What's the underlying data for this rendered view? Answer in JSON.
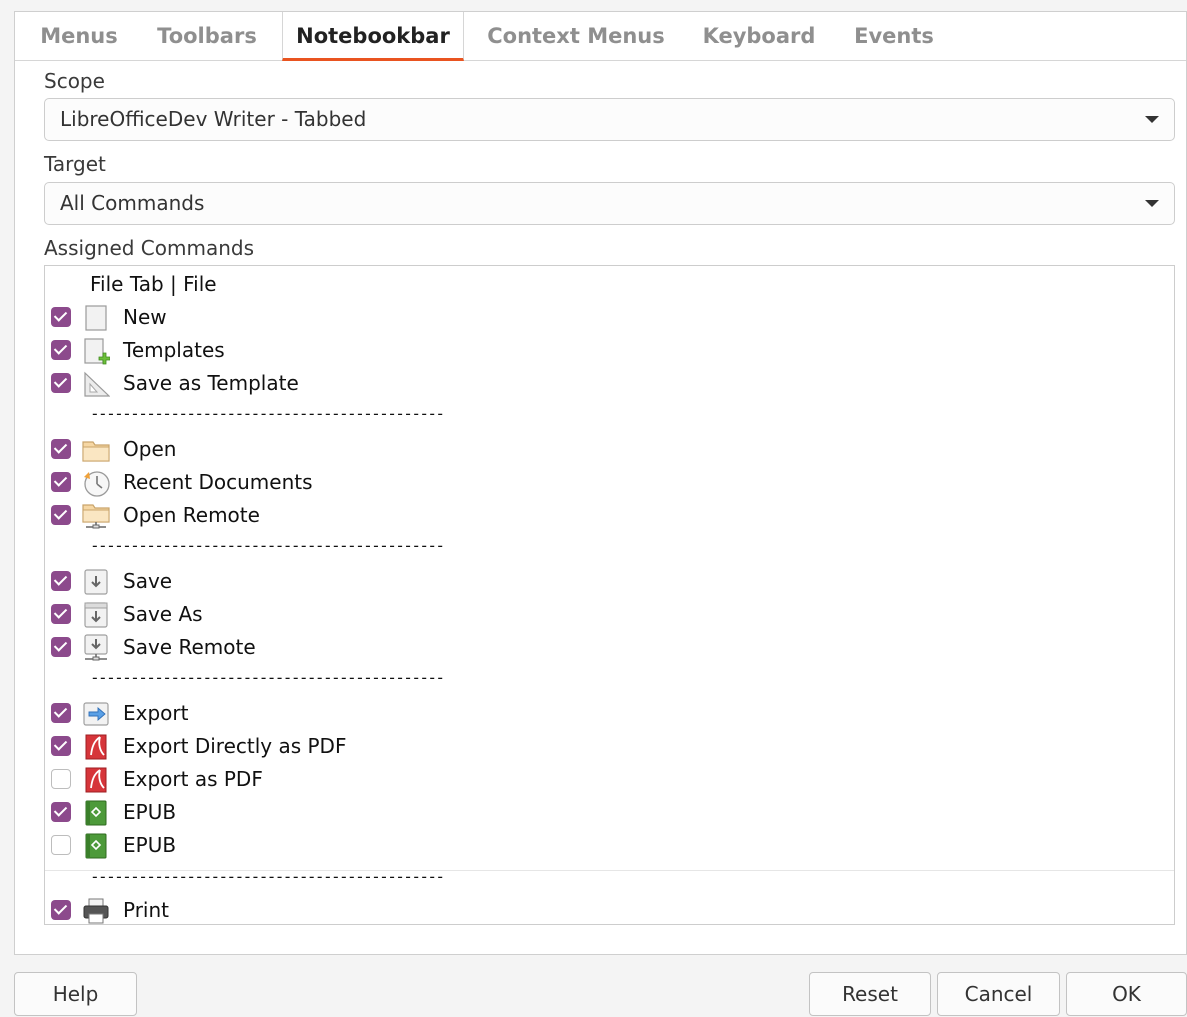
{
  "tabs": [
    {
      "label": "Menus",
      "active": false
    },
    {
      "label": "Toolbars",
      "active": false
    },
    {
      "label": "Notebookbar",
      "active": true
    },
    {
      "label": "Context Menus",
      "active": false
    },
    {
      "label": "Keyboard",
      "active": false
    },
    {
      "label": "Events",
      "active": false
    }
  ],
  "scope": {
    "label": "Scope",
    "value": "LibreOfficeDev Writer -  Tabbed"
  },
  "target": {
    "label": "Target",
    "value": "All Commands"
  },
  "assigned": {
    "label": "Assigned Commands",
    "group_header": "File Tab | File",
    "separator": "--------------------------------------------",
    "items": [
      {
        "type": "item",
        "label": "New",
        "checked": true,
        "icon": "new-document-icon"
      },
      {
        "type": "item",
        "label": "Templates",
        "checked": true,
        "icon": "templates-icon"
      },
      {
        "type": "item",
        "label": "Save as Template",
        "checked": true,
        "icon": "set-square-icon"
      },
      {
        "type": "separator"
      },
      {
        "type": "item",
        "label": "Open",
        "checked": true,
        "icon": "folder-icon"
      },
      {
        "type": "item",
        "label": "Recent Documents",
        "checked": true,
        "icon": "clock-icon"
      },
      {
        "type": "item",
        "label": "Open Remote",
        "checked": true,
        "icon": "remote-folder-icon"
      },
      {
        "type": "separator"
      },
      {
        "type": "item",
        "label": "Save",
        "checked": true,
        "icon": "save-icon"
      },
      {
        "type": "item",
        "label": "Save As",
        "checked": true,
        "icon": "save-as-icon"
      },
      {
        "type": "item",
        "label": "Save Remote",
        "checked": true,
        "icon": "save-remote-icon"
      },
      {
        "type": "separator"
      },
      {
        "type": "item",
        "label": "Export",
        "checked": true,
        "icon": "export-icon"
      },
      {
        "type": "item",
        "label": "Export Directly as PDF",
        "checked": true,
        "icon": "pdf-icon"
      },
      {
        "type": "item",
        "label": "Export as PDF",
        "checked": false,
        "icon": "pdf-icon"
      },
      {
        "type": "item",
        "label": "EPUB",
        "checked": true,
        "icon": "epub-icon"
      },
      {
        "type": "item",
        "label": "EPUB",
        "checked": false,
        "icon": "epub-icon"
      },
      {
        "type": "separator"
      },
      {
        "type": "item",
        "label": "Print",
        "checked": true,
        "icon": "printer-icon"
      }
    ]
  },
  "buttons": {
    "help": "Help",
    "reset": "Reset",
    "cancel": "Cancel",
    "ok": "OK"
  },
  "colors": {
    "accent": "#e95420",
    "checkbox": "#8c4a8c"
  }
}
